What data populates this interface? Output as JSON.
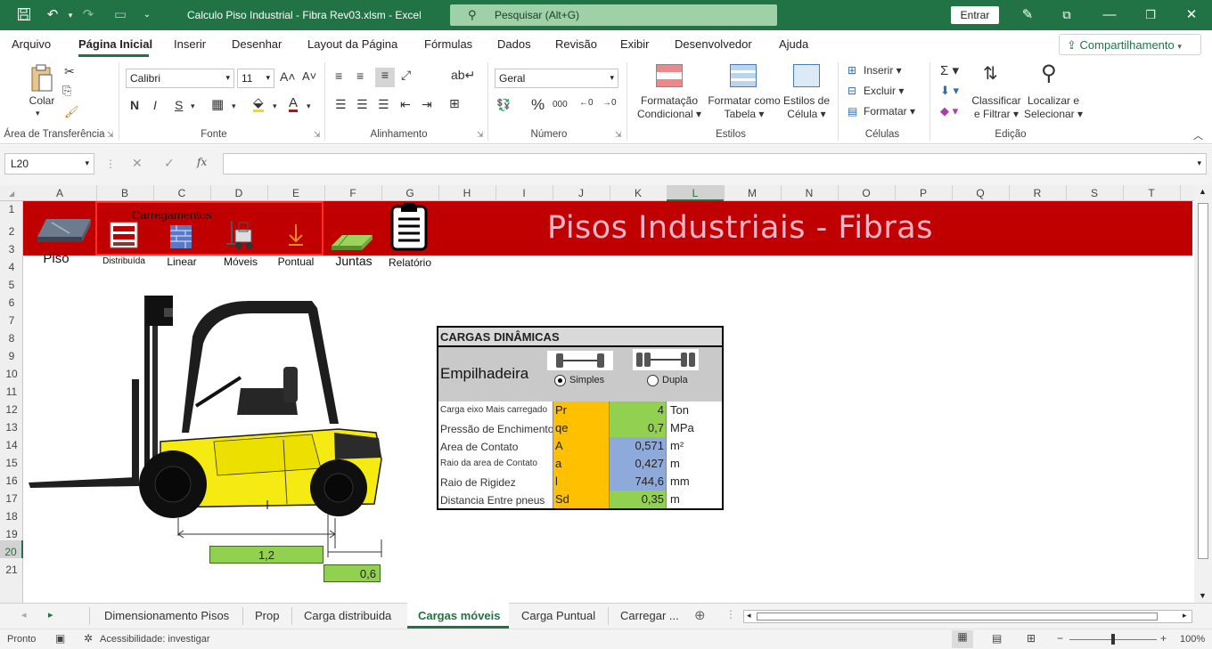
{
  "titlebar": {
    "doc_title": "Calculo Piso Industrial - Fibra Rev03.xlsm  -  Excel",
    "search_placeholder": "Pesquisar (Alt+G)",
    "signin_label": "Entrar"
  },
  "menu": {
    "tabs": [
      "Arquivo",
      "Página Inicial",
      "Inserir",
      "Desenhar",
      "Layout da Página",
      "Fórmulas",
      "Dados",
      "Revisão",
      "Exibir",
      "Desenvolvedor",
      "Ajuda"
    ],
    "active": "Página Inicial",
    "share_label": "Compartilhamento"
  },
  "ribbon": {
    "clipboard": {
      "paste_label": "Colar",
      "group_label": "Área de Transferência"
    },
    "font": {
      "name": "Calibri",
      "size": "11",
      "bold": "N",
      "italic": "I",
      "underline": "S",
      "group_label": "Fonte"
    },
    "alignment": {
      "group_label": "Alinhamento"
    },
    "number": {
      "format": "Geral",
      "group_label": "Número"
    },
    "styles": {
      "cond_format": [
        "Formatação",
        "Condicional"
      ],
      "format_table": [
        "Formatar como",
        "Tabela"
      ],
      "cell_styles": [
        "Estilos de",
        "Célula"
      ],
      "group_label": "Estilos"
    },
    "cells": {
      "insert": "Inserir",
      "delete": "Excluir",
      "format": "Formatar",
      "group_label": "Células"
    },
    "editing": {
      "sort": [
        "Classificar",
        "e Filtrar"
      ],
      "find": [
        "Localizar e",
        "Selecionar"
      ],
      "group_label": "Edição"
    }
  },
  "formula_bar": {
    "name_box": "L20",
    "formula": ""
  },
  "columns": [
    "A",
    "B",
    "C",
    "D",
    "E",
    "F",
    "G",
    "H",
    "I",
    "J",
    "K",
    "L",
    "M",
    "N",
    "O",
    "P",
    "Q",
    "R",
    "S",
    "T"
  ],
  "rows": [
    "1",
    "2",
    "3",
    "4",
    "5",
    "6",
    "7",
    "8",
    "9",
    "10",
    "11",
    "12",
    "13",
    "14",
    "15",
    "16",
    "17",
    "18",
    "19",
    "20",
    "21"
  ],
  "sheet": {
    "banner_title": "Pisos Industriais - Fibras",
    "nav": {
      "piso": "Piso",
      "carregamentos": "Carregamentos",
      "distribuida": "Distribuída",
      "linear": "Linear",
      "moveis": "Móveis",
      "pontual": "Pontual",
      "juntas": "Juntas",
      "relatorio": "Relatório"
    },
    "dim_axle": "1,2",
    "dim_wheel": "0,6",
    "table": {
      "title": "CARGAS DINÂMICAS",
      "vehicle": "Empilhadeira",
      "option_single": "Simples",
      "option_double": "Dupla",
      "selected": "Simples",
      "rows": [
        {
          "label": "Carga eixo Mais carregado",
          "symbol": "Pr",
          "value": "4",
          "unit": "Ton"
        },
        {
          "label": "Pressão de Enchimento",
          "symbol": "qe",
          "value": "0,7",
          "unit": "MPa"
        },
        {
          "label": "Area de Contato",
          "symbol": "A",
          "value": "0,571",
          "unit": "m²"
        },
        {
          "label": "Raio da area de Contato",
          "symbol": "a",
          "value": "0,427",
          "unit": "m"
        },
        {
          "label": "Raio de Rigidez",
          "symbol": "l",
          "value": "744,6",
          "unit": "mm"
        },
        {
          "label": "Distancia Entre pneus",
          "symbol": "Sd",
          "value": "0,35",
          "unit": "m"
        }
      ]
    }
  },
  "sheet_tabs": {
    "tabs": [
      "Dimensionamento Pisos",
      "Prop",
      "Carga distribuida",
      "Cargas móveis",
      "Carga Puntual",
      "Carregar ..."
    ],
    "active": "Cargas móveis"
  },
  "status": {
    "ready": "Pronto",
    "accessibility": "Acessibilidade: investigar",
    "zoom": "100%"
  },
  "colors": {
    "excel_green": "#217346",
    "banner_red": "#c00000",
    "orange": "#ffc000",
    "green_cell": "#92d050",
    "blue_cell": "#8eaadb"
  }
}
